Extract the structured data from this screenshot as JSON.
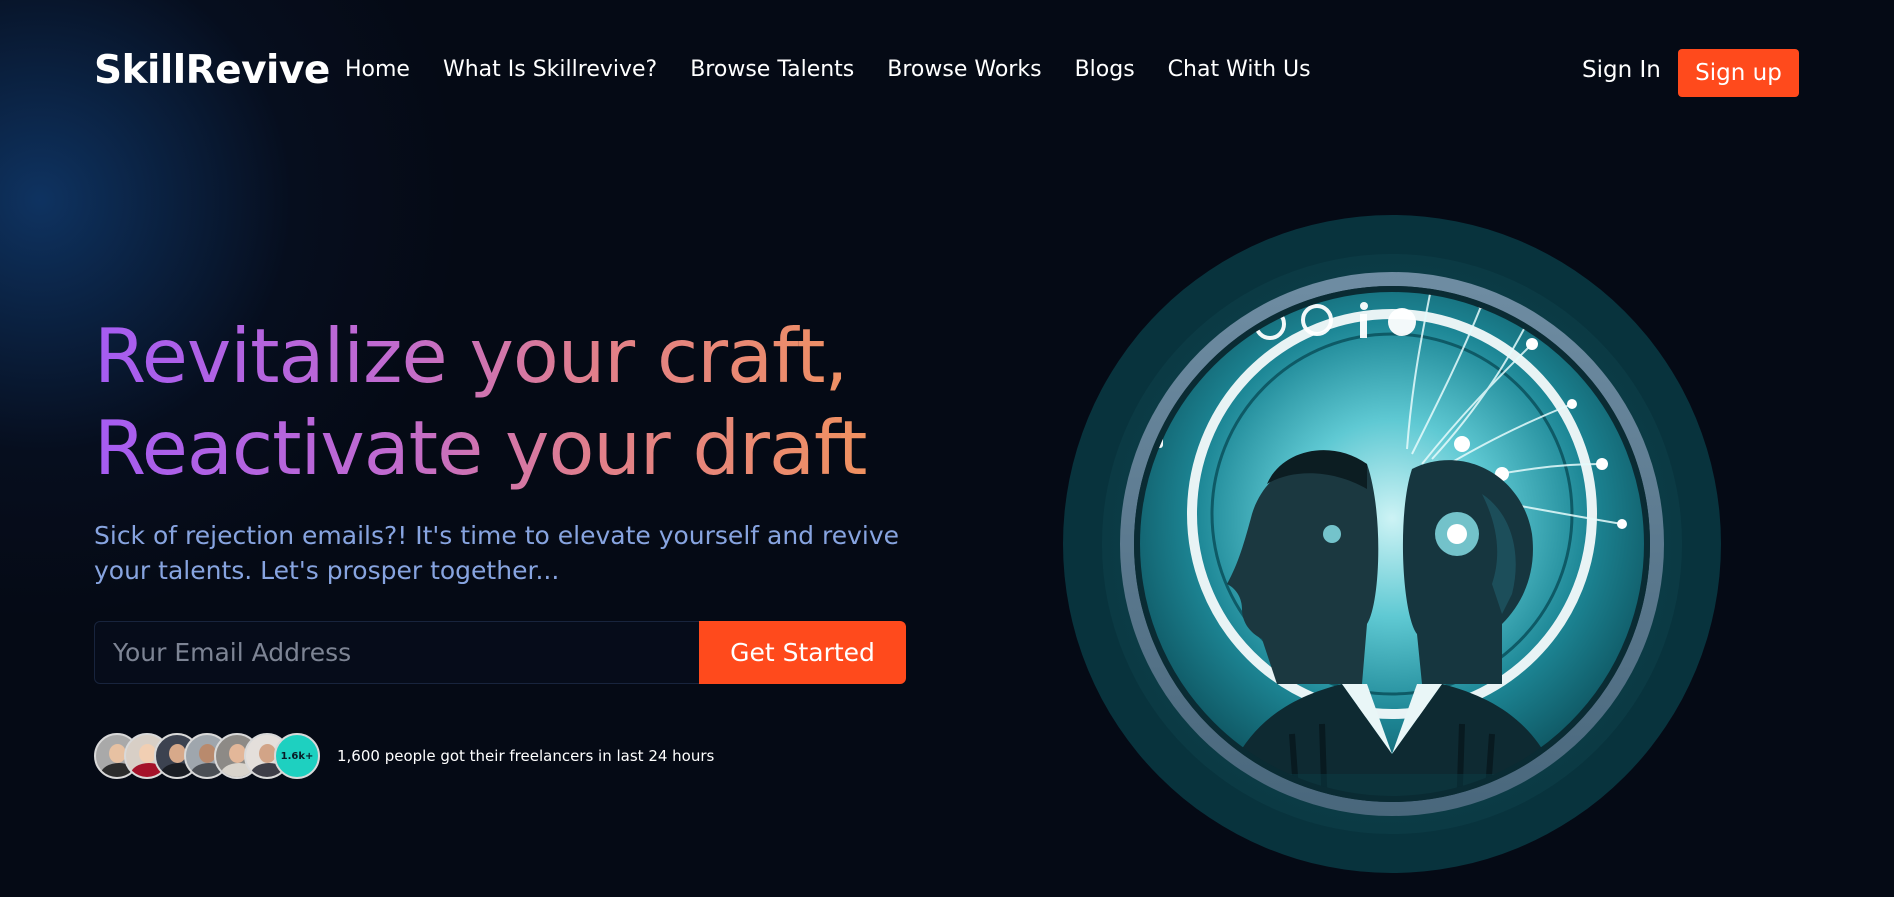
{
  "brand": {
    "logo": "SkillRevive"
  },
  "nav": {
    "links": [
      "Home",
      "What Is Skillrevive?",
      "Browse Talents",
      "Browse Works",
      "Blogs",
      "Chat With Us"
    ],
    "sign_in": "Sign In",
    "sign_up": "Sign up"
  },
  "hero": {
    "headline_line1": "Revitalize your craft,",
    "headline_line2": "Reactivate your draft",
    "subtitle": "Sick of rejection emails?! It's time to elevate yourself and revive your talents. Let's prosper together...",
    "email_placeholder": "Your Email Address",
    "cta": "Get Started",
    "social_proof_badge": "1.6k+",
    "social_proof_text": "1,600 people got their freelancers in last 24 hours"
  },
  "colors": {
    "accent": "#ff4a1c",
    "background": "#050a15",
    "subtitle": "#87a4e0",
    "headline_gradient": [
      "#a55cf2",
      "#f09160"
    ],
    "badge": "#1ed0c0"
  },
  "illustration": {
    "icon": "ai-twin-heads-illustration"
  }
}
